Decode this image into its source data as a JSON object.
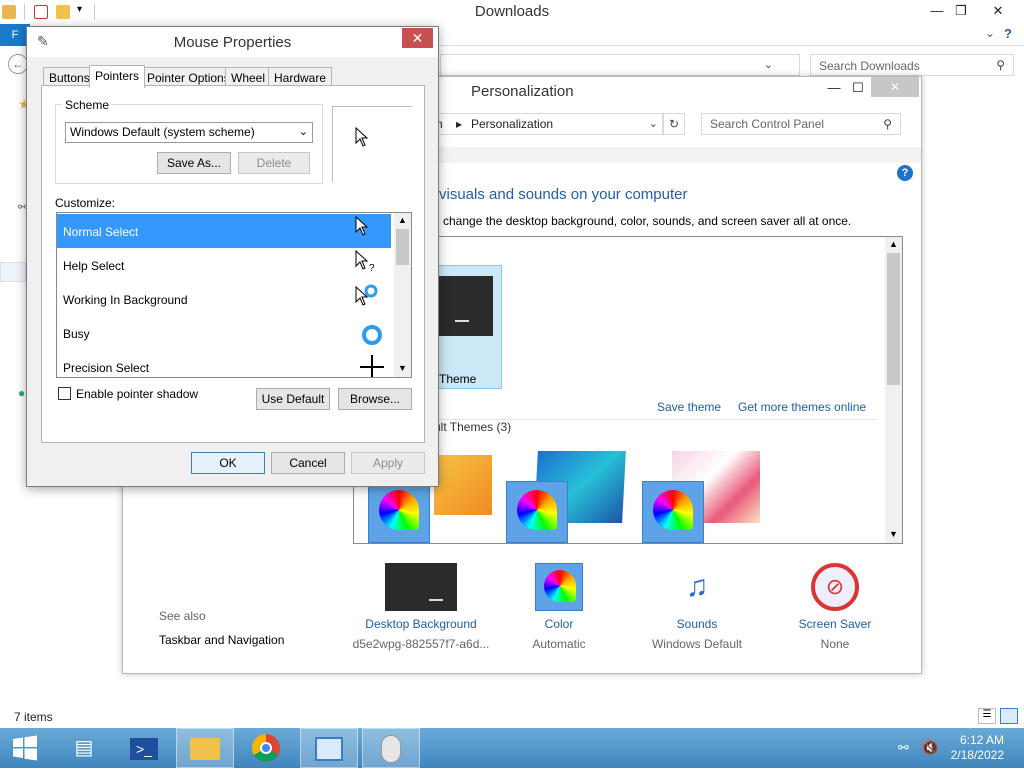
{
  "explorer": {
    "title": "Downloads",
    "file_tab": "F",
    "search_placeholder": "Search Downloads",
    "status": "7 items",
    "controls": {
      "minimize": "—",
      "restore": "❐",
      "close": "✕"
    }
  },
  "personalization": {
    "title": "Personalization",
    "breadcrumb_prefix": "n",
    "breadcrumb_item": "Personalization",
    "search_placeholder": "Search Control Panel",
    "heading": "visuals and sounds on your computer",
    "subheading": "change the desktop background, color, sounds, and screen saver all at once.",
    "paren_fragment": ")",
    "my_theme_label": "Theme",
    "save_theme": "Save theme",
    "get_more_themes": "Get more themes online",
    "default_themes_label": "ult Themes (3)",
    "see_also": "See also",
    "taskbar_nav": "Taskbar and Navigation",
    "bottom": [
      {
        "label": "Desktop Background",
        "sub": "d5e2wpg-882557f7-a6d..."
      },
      {
        "label": "Color",
        "sub": "Automatic"
      },
      {
        "label": "Sounds",
        "sub": "Windows Default"
      },
      {
        "label": "Screen Saver",
        "sub": "None"
      }
    ]
  },
  "mouse": {
    "title": "Mouse Properties",
    "tabs": [
      "Buttons",
      "Pointers",
      "Pointer Options",
      "Wheel",
      "Hardware"
    ],
    "scheme_label": "Scheme",
    "scheme_value": "Windows Default (system scheme)",
    "save_as": "Save As...",
    "delete": "Delete",
    "customize_label": "Customize:",
    "pointers": [
      {
        "name": "Normal Select",
        "glyph": "arrow"
      },
      {
        "name": "Help Select",
        "glyph": "help"
      },
      {
        "name": "Working In Background",
        "glyph": "working"
      },
      {
        "name": "Busy",
        "glyph": "busy"
      },
      {
        "name": "Precision Select",
        "glyph": "cross"
      }
    ],
    "shadow_label": "Enable pointer shadow",
    "use_default": "Use Default",
    "browse": "Browse...",
    "ok": "OK",
    "cancel": "Cancel",
    "apply": "Apply"
  },
  "taskbar": {
    "time": "6:12 AM",
    "date": "2/18/2022"
  }
}
